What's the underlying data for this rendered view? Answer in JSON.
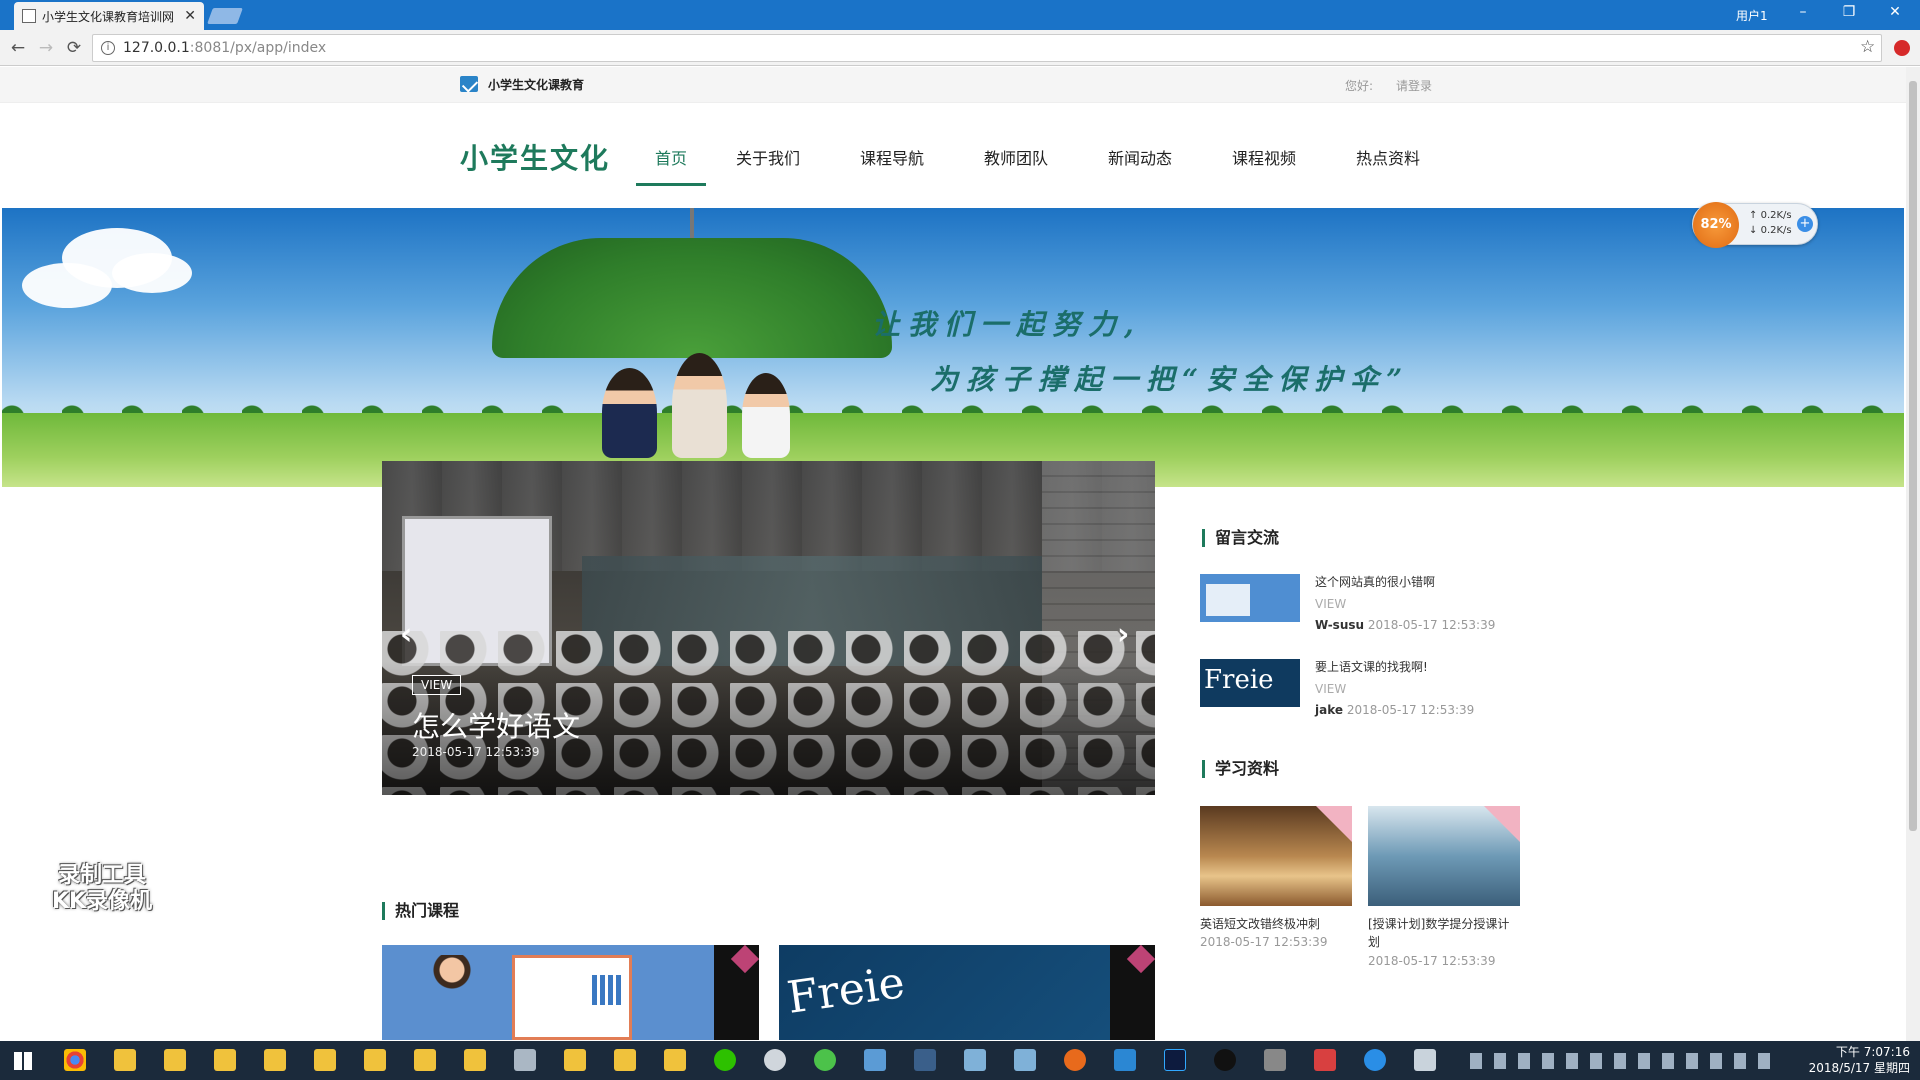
{
  "browser": {
    "tab_title": "小学生文化课教育培训网",
    "url_host": "127.0.0.1",
    "url_path": ":8081/px/app/index",
    "user_label": "用户1",
    "minimize": "–",
    "restore": "❐",
    "close": "✕",
    "back_icon": "←",
    "forward_icon": "→",
    "reload_icon": "⟳",
    "star_icon": "☆"
  },
  "topbar": {
    "site_name": "小学生文化课教育",
    "greeting": "您好:",
    "login": "请登录"
  },
  "header": {
    "brand": "小学生文化",
    "nav": [
      "首页",
      "关于我们",
      "课程导航",
      "教师团队",
      "新闻动态",
      "课程视频",
      "热点资料"
    ],
    "active_index": 0
  },
  "banner": {
    "slogan_line1": "让我们一起努力,",
    "slogan_line2": "为孩子撑起一把“安全保护伞”"
  },
  "net_widget": {
    "percent": "82%",
    "up": "0.2K/s",
    "down": "0.2K/s",
    "up_arrow": "↑",
    "down_arrow": "↓",
    "plus": "+"
  },
  "carousel": {
    "view_label": "VIEW",
    "title": "怎么学好语文",
    "date": "2018-05-17 12:53:39",
    "prev": "‹",
    "next": "›"
  },
  "hot_courses": {
    "title": "热门课程",
    "course2_text": "Freie"
  },
  "messages": {
    "title": "留言交流",
    "items": [
      {
        "text": "这个网站真的很小错啊",
        "view": "VIEW",
        "author": "W-susu",
        "date": "2018-05-17 12:53:39"
      },
      {
        "text": "要上语文课的找我啊!",
        "view": "VIEW",
        "author": "jake",
        "date": "2018-05-17 12:53:39",
        "thumb_text": "Freie"
      }
    ]
  },
  "materials": {
    "title": "学习资料",
    "items": [
      {
        "caption": "英语短文改错终极冲刺",
        "date": "2018-05-17 12:53:39"
      },
      {
        "caption": "[授课计划]数学提分授课计划",
        "date": "2018-05-17 12:53:39"
      }
    ]
  },
  "watermark": {
    "line1": "录制工具",
    "line2": "KK录像机"
  },
  "taskbar": {
    "time": "下午 7:07:16",
    "date": "2018/5/17 星期四"
  }
}
